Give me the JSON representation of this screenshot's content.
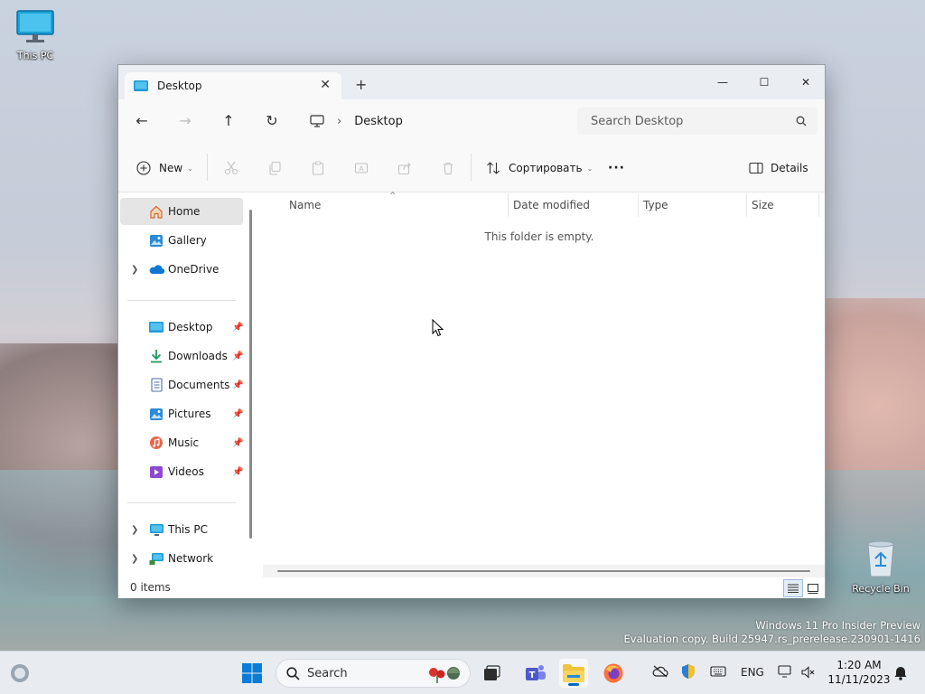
{
  "desktop": {
    "icons": [
      {
        "label": "This PC"
      },
      {
        "label": "Recycle Bin"
      }
    ],
    "watermark": {
      "line1": "Windows 11 Pro Insider Preview",
      "line2": "Evaluation copy. Build 25947.rs_prerelease.230901-1416"
    }
  },
  "window": {
    "tab_title": "Desktop",
    "new_tab": "+",
    "controls": {
      "minimize": "—",
      "maximize": "☐",
      "close": "✕"
    },
    "nav": {
      "back": "←",
      "forward": "→",
      "up": "↑",
      "refresh": "↻"
    },
    "breadcrumb": {
      "separator": "›",
      "current": "Desktop"
    },
    "search": {
      "placeholder": "Search Desktop"
    },
    "toolbar": {
      "new_label": "New",
      "sort_label": "Сортировать",
      "more_label": "···",
      "details_label": "Details"
    },
    "sidebar": {
      "items": [
        {
          "label": "Home",
          "icon": "home-icon",
          "selected": true
        },
        {
          "label": "Gallery",
          "icon": "gallery-icon"
        },
        {
          "label": "OneDrive",
          "icon": "onedrive-icon"
        },
        {
          "label": "Desktop",
          "icon": "desktop-folder-icon",
          "pinned": true
        },
        {
          "label": "Downloads",
          "icon": "downloads-icon",
          "pinned": true
        },
        {
          "label": "Documents",
          "icon": "documents-icon",
          "pinned": true
        },
        {
          "label": "Pictures",
          "icon": "pictures-icon",
          "pinned": true
        },
        {
          "label": "Music",
          "icon": "music-icon",
          "pinned": true
        },
        {
          "label": "Videos",
          "icon": "videos-icon",
          "pinned": true
        },
        {
          "label": "This PC",
          "icon": "this-pc-icon"
        },
        {
          "label": "Network",
          "icon": "network-icon"
        }
      ]
    },
    "columns": [
      "Name",
      "Date modified",
      "Type",
      "Size"
    ],
    "empty_message": "This folder is empty.",
    "status": "0 items"
  },
  "taskbar": {
    "search_label": "Search",
    "tray": {
      "language": "ENG",
      "time": "1:20 AM",
      "date": "11/11/2023"
    }
  },
  "colors": {
    "accent": "#0067c0",
    "folder_yellow": "#f0c33c"
  }
}
